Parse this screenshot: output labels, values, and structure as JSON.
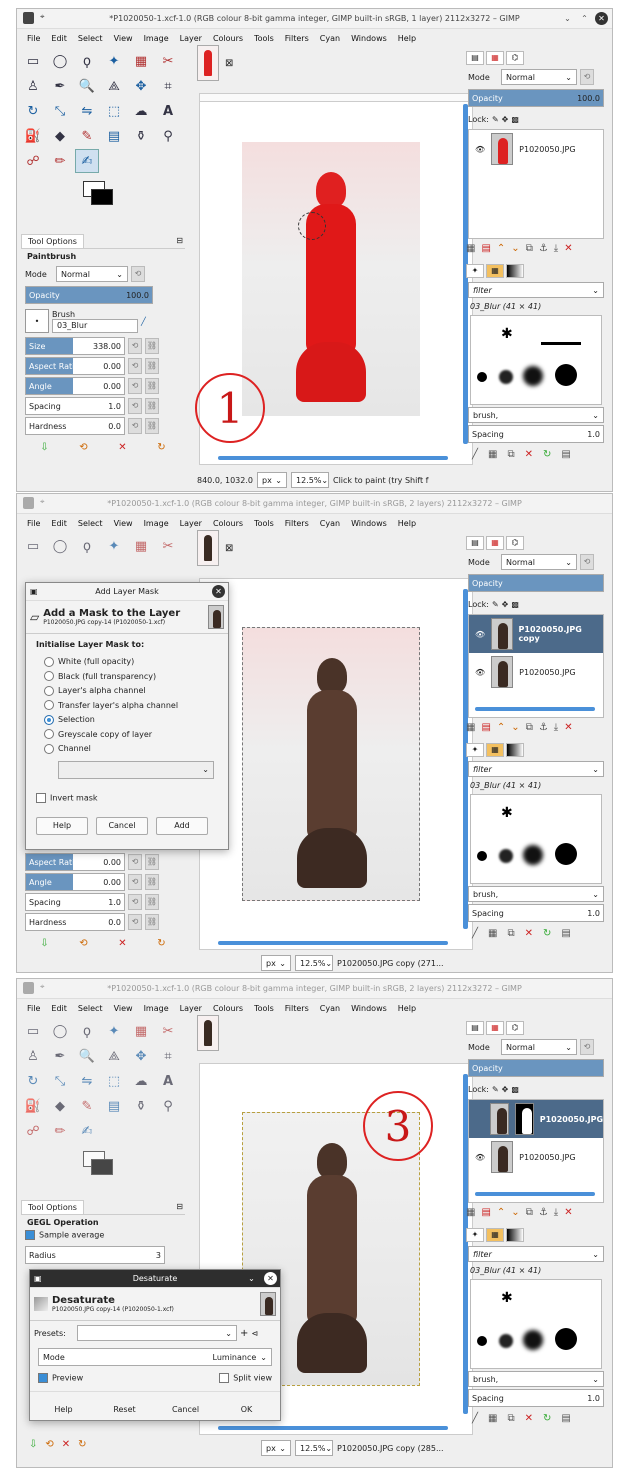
{
  "menu": [
    "File",
    "Edit",
    "Select",
    "View",
    "Image",
    "Layer",
    "Colours",
    "Tools",
    "Filters",
    "Cyan",
    "Windows",
    "Help"
  ],
  "panel1": {
    "title": "*P1020050-1.xcf-1.0 (RGB colour 8-bit gamma integer, GIMP built-in sRGB, 1 layer) 2112x3272 – GIMP",
    "tool_options_tab": "Tool Options",
    "tool_name": "Paintbrush",
    "mode_label": "Mode",
    "mode_value": "Normal",
    "opacity_label": "Opacity",
    "opacity_value": "100.0",
    "brush_label": "Brush",
    "brush_value": "03_Blur",
    "size_label": "Size",
    "size_value": "338.00",
    "aspect_label": "Aspect Ratio",
    "aspect_value": "0.00",
    "angle_label": "Angle",
    "angle_value": "0.00",
    "spacing_label": "Spacing",
    "spacing_value": "1.0",
    "hardness_label": "Hardness",
    "hardness_value": "0.0",
    "coords": "840.0, 1032.0",
    "unit": "px",
    "zoom": "12.5%",
    "status": "Click to paint (try Shift f",
    "layers_mode_label": "Mode",
    "layers_mode_value": "Normal",
    "layers_opacity_label": "Opacity",
    "layers_opacity_value": "100.0",
    "lock_label": "Lock:",
    "layer_name": "P1020050.JPG",
    "brush_filter": "filter",
    "brush_name": "03_Blur (41 × 41)",
    "brush_tag": "brush,",
    "brush_spacing_label": "Spacing",
    "brush_spacing_value": "1.0",
    "callout": "1"
  },
  "panel2": {
    "title": "*P1020050-1.xcf-1.0 (RGB colour 8-bit gamma integer, GIMP built-in sRGB, 2 layers) 2112x3272 – GIMP",
    "dialog_title": "Add Layer Mask",
    "dialog_heading": "Add a Mask to the Layer",
    "dialog_sub": "P1020050.JPG copy-14 (P1020050-1.xcf)",
    "init_label": "Initialise Layer Mask to:",
    "options": [
      "White (full opacity)",
      "Black (full transparency)",
      "Layer's alpha channel",
      "Transfer layer's alpha channel",
      "Selection",
      "Greyscale copy of layer",
      "Channel"
    ],
    "invert_label": "Invert mask",
    "help": "Help",
    "cancel": "Cancel",
    "add": "Add",
    "aspect_label": "Aspect Ratio",
    "aspect_value": "0.00",
    "angle_label": "Angle",
    "angle_value": "0.00",
    "spacing_label": "Spacing",
    "spacing_value": "1.0",
    "hardness_label": "Hardness",
    "hardness_value": "0.0",
    "unit": "px",
    "zoom": "12.5%",
    "status": "P1020050.JPG copy (271...",
    "layers_mode_label": "Mode",
    "layers_mode_value": "Normal",
    "layers_opacity_label": "Opacity",
    "lock_label": "Lock:",
    "layer1_name": "P1020050.JPG copy",
    "layer2_name": "P1020050.JPG",
    "brush_filter": "filter",
    "brush_name": "03_Blur (41 × 41)",
    "brush_tag": "brush,",
    "brush_spacing_label": "Spacing",
    "brush_spacing_value": "1.0",
    "callout": "2"
  },
  "panel3": {
    "title": "*P1020050-1.xcf-1.0 (RGB colour 8-bit gamma integer, GIMP built-in sRGB, 2 layers) 2112x3272 – GIMP",
    "tool_options_tab": "Tool Options",
    "gegl_label": "GEGL Operation",
    "sample_label": "Sample average",
    "radius_label": "Radius",
    "radius_value": "3",
    "dialog_title": "Desaturate",
    "dialog_heading": "Desaturate",
    "dialog_sub": "P1020050.JPG copy-14 (P1020050-1.xcf)",
    "presets_label": "Presets:",
    "mode_label": "Mode",
    "mode_value": "Luminance",
    "preview_label": "Preview",
    "split_label": "Split view",
    "help": "Help",
    "reset": "Reset",
    "cancel": "Cancel",
    "ok": "OK",
    "unit": "px",
    "zoom": "12.5%",
    "status": "P1020050.JPG copy (285...",
    "layers_mode_label": "Mode",
    "layers_mode_value": "Normal",
    "layers_opacity_label": "Opacity",
    "lock_label": "Lock:",
    "layer1_name": "P1020050.JPG",
    "layer2_name": "P1020050.JPG",
    "brush_filter": "filter",
    "brush_name": "03_Blur (41 × 41)",
    "brush_tag": "brush,",
    "brush_spacing_label": "Spacing",
    "brush_spacing_value": "1.0",
    "callout": "3"
  }
}
